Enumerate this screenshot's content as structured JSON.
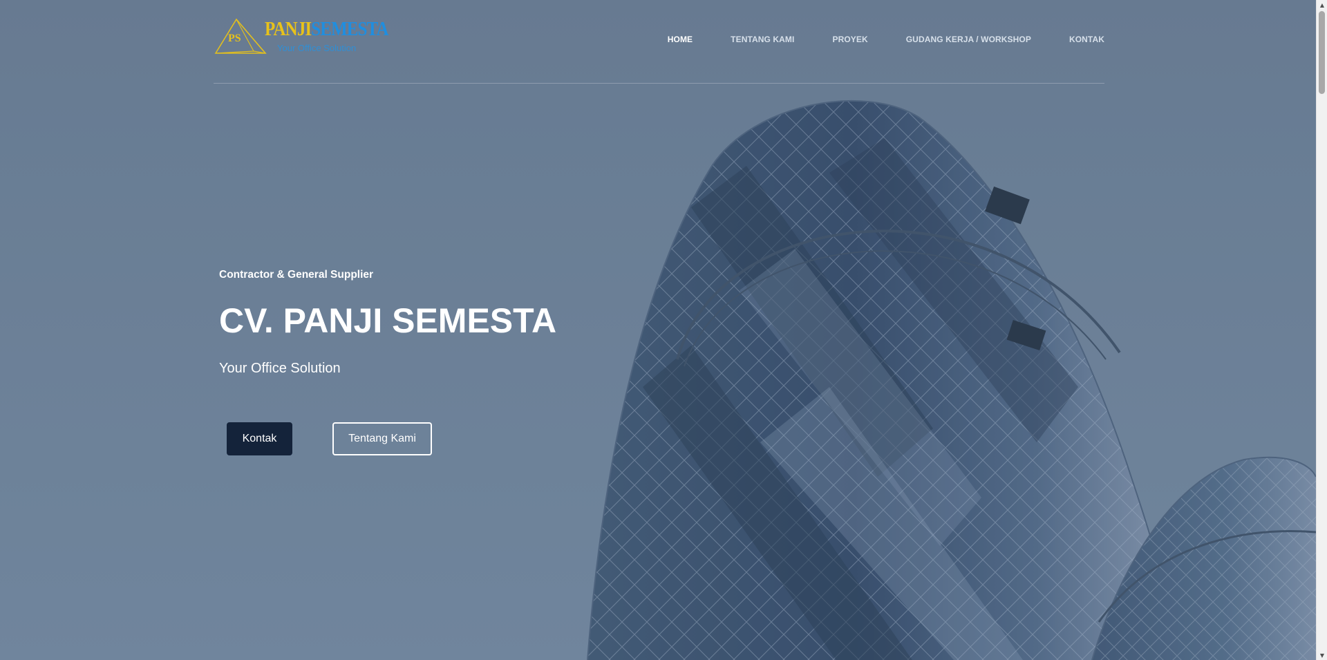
{
  "header": {
    "logo": {
      "letters": "PS",
      "name_part1": "PANJI",
      "name_part2": "SEMESTA",
      "tagline": "Your Office Solution"
    },
    "nav": [
      {
        "label": "HOME",
        "active": true
      },
      {
        "label": "TENTANG KAMI",
        "active": false
      },
      {
        "label": "PROYEK",
        "active": false
      },
      {
        "label": "GUDANG KERJA / WORKSHOP",
        "active": false
      },
      {
        "label": "KONTAK",
        "active": false
      }
    ]
  },
  "hero": {
    "subtitle": "Contractor & General Supplier",
    "title": "CV. PANJI SEMESTA",
    "tagline": "Your Office Solution",
    "primary_button": "Kontak",
    "secondary_button": "Tentang Kami",
    "background_image": "glass-skyscraper-towers"
  },
  "colors": {
    "brand_yellow": "#e8c21a",
    "brand_blue": "#1f8ee0",
    "button_dark": "#14233a",
    "overlay": "#687c93"
  }
}
